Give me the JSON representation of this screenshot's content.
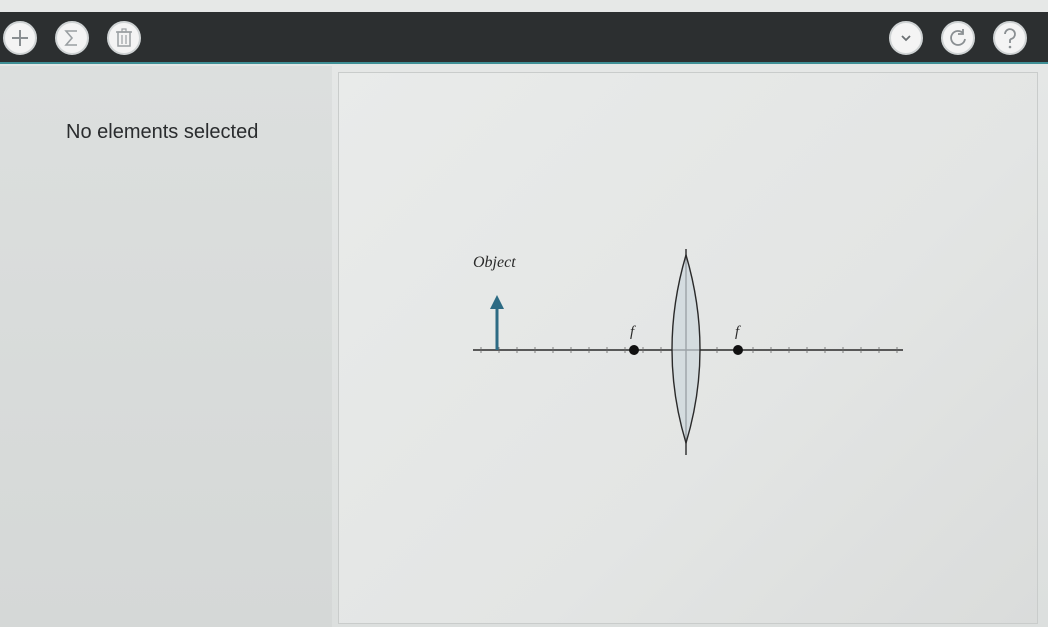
{
  "toolbar": {
    "left_buttons": [
      {
        "name": "add",
        "icon": "plus-icon"
      },
      {
        "name": "sum",
        "icon": "sigma-icon"
      },
      {
        "name": "delete",
        "icon": "trash-icon"
      }
    ],
    "right_buttons": [
      {
        "name": "expand",
        "icon": "chevron-down-icon"
      },
      {
        "name": "reset",
        "icon": "refresh-icon"
      },
      {
        "name": "help",
        "icon": "question-icon"
      }
    ],
    "accent_color": "#3f8f95",
    "bar_color": "#2c2f30"
  },
  "sidebar": {
    "status": "No elements selected"
  },
  "diagram": {
    "object_label": "Object",
    "focal_label_left": "f",
    "focal_label_right": "f",
    "arrow_color": "#2d6b84"
  }
}
